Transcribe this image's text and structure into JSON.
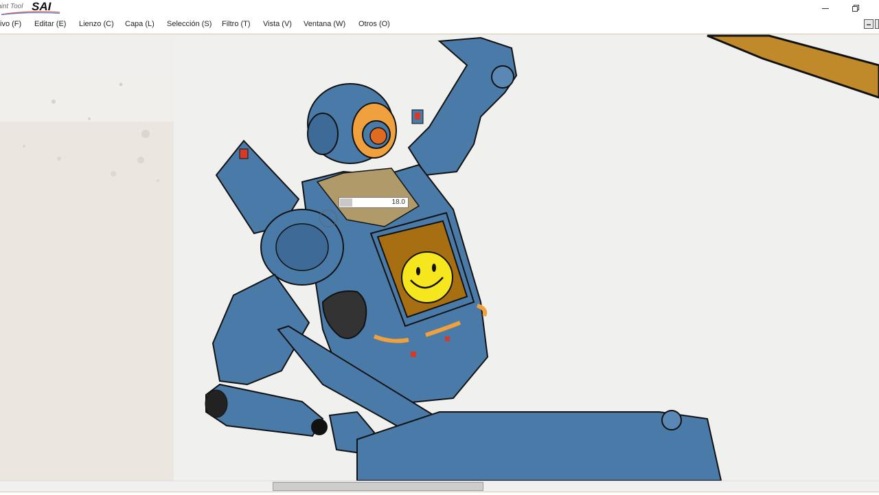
{
  "app": {
    "logo_prefix": "aint Tool",
    "logo_main": "SAI"
  },
  "window": {
    "minimize_glyph": "—",
    "restore_glyph": "❐"
  },
  "menu": [
    {
      "label": "ivo (F)"
    },
    {
      "label": "Editar (E)"
    },
    {
      "label": "Lienzo (C)"
    },
    {
      "label": "Capa (L)"
    },
    {
      "label": "Selección (S)"
    },
    {
      "label": "Filtro (T)"
    },
    {
      "label": "Vista (V)"
    },
    {
      "label": "Ventana (W)"
    },
    {
      "label": "Otros (O)"
    }
  ],
  "brush_size": {
    "value": "18.0",
    "fill_fraction": 0.18
  },
  "scrollbar": {
    "thumb_fraction_start": 0.31,
    "thumb_fraction_span": 0.24
  },
  "colors": {
    "robot_blue": "#4a7aa8",
    "accent_orange": "#f0a03c",
    "smiley_yellow": "#f5e61e",
    "screen_brown": "#a86e12",
    "beam_gold": "#c08a2a"
  },
  "icons": {
    "minimize": "minimize-icon",
    "restore": "restore-icon",
    "brush_cursor": "brush-cursor-icon"
  }
}
